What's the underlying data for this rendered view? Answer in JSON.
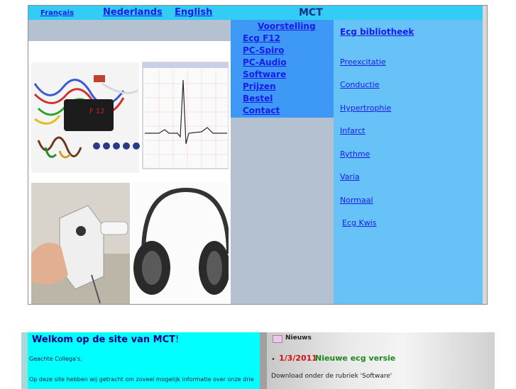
{
  "header": {
    "languages": [
      "Français",
      "Nederlands",
      "English"
    ],
    "site_title": "MCT"
  },
  "nav": [
    "Voorstelling",
    "Ecg F12",
    "PC-Spiro",
    "PC-Audio",
    "Software",
    "Prijzen",
    "Bestel",
    "Contact"
  ],
  "library": {
    "title": "Ecg bibliotheek",
    "items": [
      "Preexcitatie",
      "Conductie",
      "Hypertrophie",
      "Infarct",
      "Rythme",
      "Varia",
      "Normaal",
      "Ecg Kwis"
    ]
  },
  "device_label": "F 12",
  "welcome": {
    "title": "Welkom op de site van MCT",
    "exclaim": "!",
    "greeting": "Geachte Collega's,",
    "body": "Op deze site hebben wij getracht om zoveel mogelijk informatie over onze drie"
  },
  "news": {
    "heading": "Nieuws",
    "date": "1/3/2011",
    "title": "Nieuwe ecg versie",
    "text": "Download onder de rubriek 'Software'"
  },
  "colors": {
    "topbar": "#33ccf5",
    "nav_box": "#3d99f5",
    "library": "#66c2f7",
    "welcome": "#00ffff"
  }
}
